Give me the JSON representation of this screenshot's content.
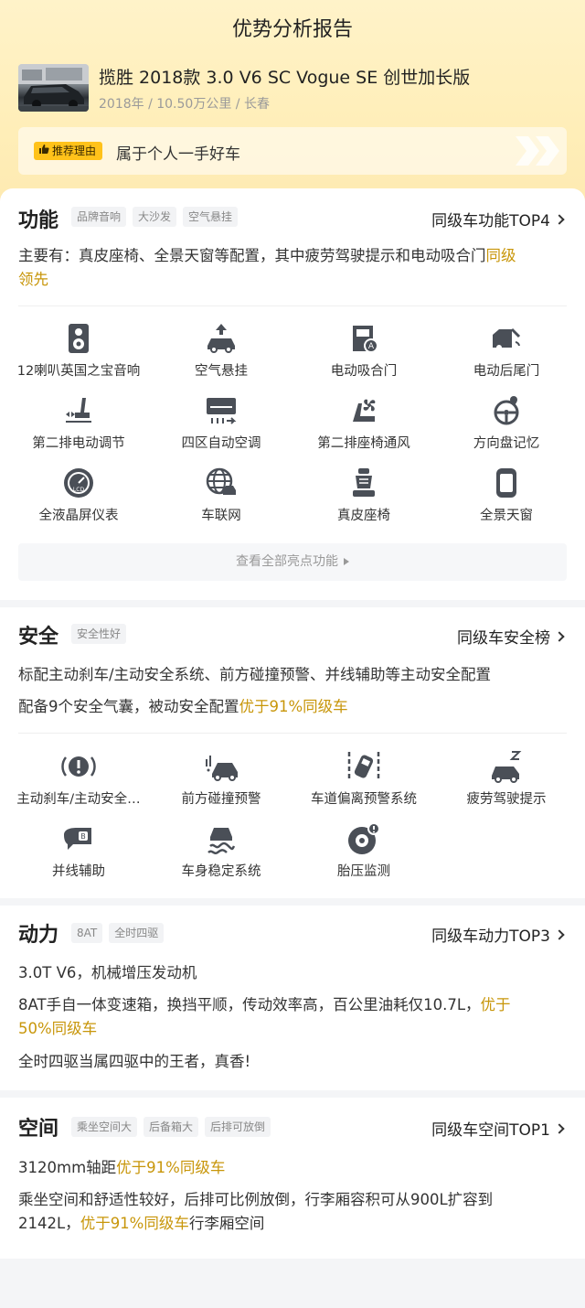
{
  "page_title": "优势分析报告",
  "car": {
    "title": "揽胜 2018款 3.0 V6 SC Vogue SE 创世加长版",
    "meta": "2018年 / 10.50万公里 / 长春"
  },
  "reason": {
    "tag": "推荐理由",
    "text": "属于个人一手好车"
  },
  "function": {
    "title": "功能",
    "tags": [
      "品牌音响",
      "大沙发",
      "空气悬挂"
    ],
    "rank": "同级车功能TOP4",
    "desc_prefix": "主要有：真皮座椅、全景天窗等配置，其中疲劳驾驶提示和电动吸合门",
    "desc_highlight_a": "同级",
    "desc_highlight_b": "领先",
    "features": [
      {
        "label": "12喇叭英国之宝音响",
        "icon": "speaker-icon"
      },
      {
        "label": "空气悬挂",
        "icon": "air-suspension-icon"
      },
      {
        "label": "电动吸合门",
        "icon": "soft-close-door-icon"
      },
      {
        "label": "电动后尾门",
        "icon": "power-tailgate-icon"
      },
      {
        "label": "第二排电动调节",
        "icon": "seat-adjust-icon"
      },
      {
        "label": "四区自动空调",
        "icon": "climate-control-icon"
      },
      {
        "label": "第二排座椅通风",
        "icon": "seat-ventilation-icon"
      },
      {
        "label": "方向盘记忆",
        "icon": "steering-memory-icon"
      },
      {
        "label": "全液晶屏仪表",
        "icon": "lcd-gauge-icon"
      },
      {
        "label": "车联网",
        "icon": "connected-car-icon"
      },
      {
        "label": "真皮座椅",
        "icon": "leather-seat-icon"
      },
      {
        "label": "全景天窗",
        "icon": "panoramic-sunroof-icon"
      }
    ],
    "more": "查看全部亮点功能"
  },
  "safety": {
    "title": "安全",
    "tags": [
      "安全性好"
    ],
    "rank": "同级车安全榜",
    "line1": "标配主动刹车/主动安全系统、前方碰撞预警、并线辅助等主动安全配置",
    "line2_prefix": "配备9个安全气囊，被动安全配置",
    "line2_highlight": "优于91%同级车",
    "features": [
      {
        "label": "主动刹车/主动安全…",
        "icon": "active-brake-icon"
      },
      {
        "label": "前方碰撞预警",
        "icon": "collision-warning-icon"
      },
      {
        "label": "车道偏离预警系统",
        "icon": "lane-departure-icon"
      },
      {
        "label": "疲劳驾驶提示",
        "icon": "fatigue-alert-icon"
      },
      {
        "label": "并线辅助",
        "icon": "blind-spot-icon"
      },
      {
        "label": "车身稳定系统",
        "icon": "stability-control-icon"
      },
      {
        "label": "胎压监测",
        "icon": "tire-pressure-icon"
      }
    ]
  },
  "power": {
    "title": "动力",
    "tags": [
      "8AT",
      "全时四驱"
    ],
    "rank": "同级车动力TOP3",
    "line1": "3.0T V6，机械增压发动机",
    "line2_prefix": "8AT手自一体变速箱，换挡平顺，传动效率高，百公里油耗仅10.7L，",
    "line2_highlight_a": "优于",
    "line2_highlight_b": "50%同级车",
    "line3": "全时四驱当属四驱中的王者，真香!"
  },
  "space": {
    "title": "空间",
    "tags": [
      "乘坐空间大",
      "后备箱大",
      "后排可放倒"
    ],
    "rank": "同级车空间TOP1",
    "line1_prefix": "3120mm轴距",
    "line1_highlight": "优于91%同级车",
    "line2": "乘坐空间和舒适性较好，后排可比例放倒，行李厢容积可从900L扩容到",
    "line3_prefix": "2142L，",
    "line3_highlight": "优于91%同级车",
    "line3_suffix": "行李厢空间"
  },
  "colors": {
    "accent": "#ffc21a",
    "highlight": "#c8960a",
    "hero_bg": "#fff3c9"
  }
}
